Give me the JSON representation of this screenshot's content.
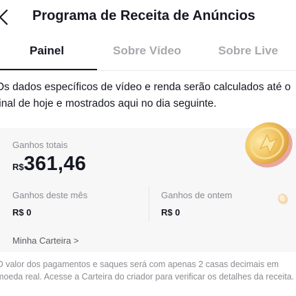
{
  "header": {
    "title": "Programa de Receita de Anúncios"
  },
  "tabs": [
    {
      "label": "Painel"
    },
    {
      "label": "Sobre Vídeo"
    },
    {
      "label": "Sobre Live"
    }
  ],
  "info": {
    "text": "Os dados específicos de vídeo e renda serão calculados até o final de hoje e mostrados aqui no dia seguinte."
  },
  "earnings": {
    "total_label": "Ganhos totais",
    "total_currency": "R$",
    "total_value": "361,46",
    "month_label": "Ganhos deste mês",
    "month_value": "R$ 0",
    "yesterday_label": "Ganhos de ontem",
    "yesterday_value": "R$ 0",
    "wallet_link": "Minha Carteira >"
  },
  "footer": {
    "note": "O valor dos pagamentos e saques será com apenas 2 casas decimais em moeda real. Acesse a Carteira do criador para verificar os detalhes da receita."
  },
  "colors": {
    "accent_text": "#161823",
    "muted_text": "#8a8b91",
    "card_bg": "#f7f7f8",
    "coin_gold": "#f0c560"
  }
}
